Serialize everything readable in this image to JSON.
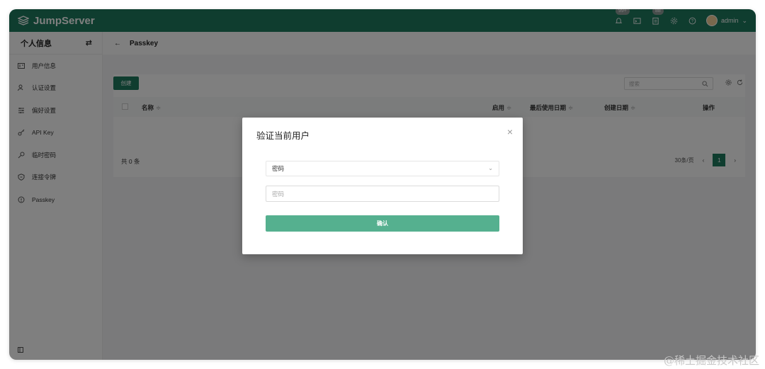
{
  "app": {
    "name": "JumpServer"
  },
  "topbar": {
    "notifications_badge": "99+",
    "tickets_badge": "88",
    "user_name": "admin",
    "user_chevron": "⌄"
  },
  "sidebar": {
    "title": "个人信息",
    "toggle_icon": "⇄",
    "items": [
      {
        "label": "用户信息",
        "icon": "id-card-icon"
      },
      {
        "label": "认证设置",
        "icon": "user-lock-icon"
      },
      {
        "label": "偏好设置",
        "icon": "sliders-icon"
      },
      {
        "label": "API Key",
        "icon": "key-icon"
      },
      {
        "label": "临时密码",
        "icon": "temp-key-icon"
      },
      {
        "label": "连接令牌",
        "icon": "token-icon"
      },
      {
        "label": "Passkey",
        "icon": "passkey-icon"
      }
    ]
  },
  "page": {
    "back_arrow": "←",
    "title": "Passkey",
    "create_label": "创建",
    "search_placeholder": "搜索",
    "columns": [
      "名称",
      "启用",
      "最后使用日期",
      "创建日期",
      "操作"
    ],
    "sort_glyph": "≑",
    "total_text": "共 0 条",
    "page_size": "30条/页",
    "prev": "‹",
    "current_page": "1",
    "next": "›"
  },
  "modal": {
    "title": "验证当前用户",
    "close": "×",
    "method_value": "密码",
    "method_chevron": "⌄",
    "password_placeholder": "密码",
    "confirm_label": "确认"
  },
  "watermark": "@稀土掘金技术社区",
  "colors": {
    "brand": "#1f7a5f",
    "confirm": "#55b08f"
  }
}
